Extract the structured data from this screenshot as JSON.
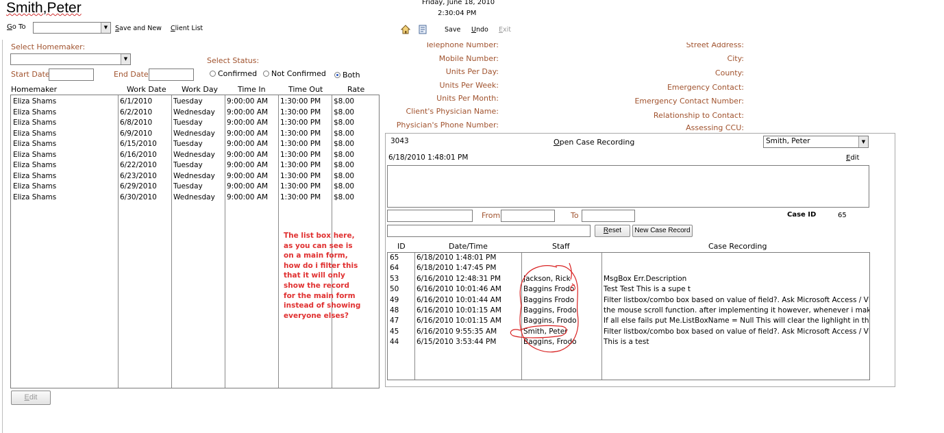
{
  "header": {
    "client_name": "Smith,Peter",
    "date": "Friday, June 18, 2010",
    "time": "2:30:04 PM",
    "goto_label": "Go To",
    "goto_value": "",
    "save_new": "Save and New",
    "client_list": "Client List",
    "save": "Save",
    "undo": "Undo",
    "exit": "Exit"
  },
  "left": {
    "cut_top_label": "Select Homemaker:",
    "homemaker_value": "",
    "select_status_label": "Select Status:",
    "start_date_label": "Start Date:",
    "start_date_value": "",
    "end_date_label": "End Date:",
    "end_date_value": "",
    "status_options": [
      "Confirmed",
      "Not Confirmed",
      "Both"
    ],
    "status_selected": "Both",
    "columns": [
      "Homemaker",
      "Work Date",
      "Work Day",
      "Time In",
      "Time Out",
      "Rate"
    ],
    "rows": [
      [
        "Eliza Shams",
        "6/1/2010",
        "Tuesday",
        "9:00:00 AM",
        "1:30:00 PM",
        "$8.00"
      ],
      [
        "Eliza Shams",
        "6/2/2010",
        "Wednesday",
        "9:00:00 AM",
        "1:30:00 PM",
        "$8.00"
      ],
      [
        "Eliza Shams",
        "6/8/2010",
        "Tuesday",
        "9:00:00 AM",
        "1:30:00 PM",
        "$8.00"
      ],
      [
        "Eliza Shams",
        "6/9/2010",
        "Wednesday",
        "9:00:00 AM",
        "1:30:00 PM",
        "$8.00"
      ],
      [
        "Eliza Shams",
        "6/15/2010",
        "Tuesday",
        "9:00:00 AM",
        "1:30:00 PM",
        "$8.00"
      ],
      [
        "Eliza Shams",
        "6/16/2010",
        "Wednesday",
        "9:00:00 AM",
        "1:30:00 PM",
        "$8.00"
      ],
      [
        "Eliza Shams",
        "6/22/2010",
        "Tuesday",
        "9:00:00 AM",
        "1:30:00 PM",
        "$8.00"
      ],
      [
        "Eliza Shams",
        "6/23/2010",
        "Wednesday",
        "9:00:00 AM",
        "1:30:00 PM",
        "$8.00"
      ],
      [
        "Eliza Shams",
        "6/29/2010",
        "Tuesday",
        "9:00:00 AM",
        "1:30:00 PM",
        "$8.00"
      ],
      [
        "Eliza Shams",
        "6/30/2010",
        "Wednesday",
        "9:00:00 AM",
        "1:30:00 PM",
        "$8.00"
      ]
    ],
    "note": "The list box here, as you can see is on a main form, how do i filter this that it will only show the record for the main form instead of showing everyone elses?",
    "edit_button": "Edit"
  },
  "right": {
    "labels_mid": [
      "Telephone Number:",
      "Mobile Number:",
      "Units Per Day:",
      "Units Per Week:",
      "Units Per Month:",
      "Client's Physician Name:",
      "Physician's Phone Number:"
    ],
    "labels_right": [
      "Street Address:",
      "City:",
      "County:",
      "Emergency Contact:",
      "Emergency Contact Number:",
      "Relationship to Contact:",
      "Assessing CCU:"
    ],
    "case": {
      "id_value": "3043",
      "open_case_recording": "Open Case Recording",
      "staff_combo": "Smith, Peter",
      "datetime": "6/18/2010 1:48:01 PM",
      "edit": "Edit",
      "from_label": "From",
      "to_label": "To",
      "case_id_label": "Case ID",
      "case_id_value": "65",
      "reset": "Reset",
      "new_case_record": "New Case Record",
      "columns": [
        "ID",
        "Date/Time",
        "Staff",
        "Case Recording"
      ],
      "rows": [
        [
          "65",
          "6/18/2010 1:48:01 PM",
          "",
          ""
        ],
        [
          "64",
          "6/18/2010 1:47:45 PM",
          "",
          ""
        ],
        [
          "53",
          "6/16/2010 12:48:31 PM",
          "Jackson, Rick",
          "MsgBox Err.Description"
        ],
        [
          "50",
          "6/16/2010 10:01:46 AM",
          "Baggins Frodo",
          "Test Test This is a supe t"
        ],
        [
          "49",
          "6/16/2010 10:01:44 AM",
          "Baggins Frodo",
          "Filter listbox/combo box based on value of field?. Ask Microsoft Access / VBA"
        ],
        [
          "48",
          "6/16/2010 10:01:15 AM",
          "Baggins, Frodo",
          "the mouse scroll function. after implementing it however, whenever i make c"
        ],
        [
          "47",
          "6/16/2010 10:01:15 AM",
          "Baggins, Frodo",
          "If all else fails put Me.ListBoxName = Null This will clear the lighlight in the lis"
        ],
        [
          "45",
          "6/16/2010 9:55:35 AM",
          "Smith, Peter",
          "Filter listbox/combo box based on value of field?. Ask Microsoft Access / VBA"
        ],
        [
          "44",
          "6/15/2010 3:53:44 PM",
          "Baggins, Frodo",
          "This is a test"
        ]
      ]
    }
  },
  "colors": {
    "label": "#a0522d",
    "note": "#e03030",
    "annotation": "#d82020"
  }
}
